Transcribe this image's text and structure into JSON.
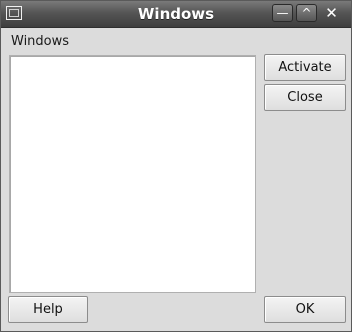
{
  "window": {
    "title": "Windows"
  },
  "titlebar": {
    "menu_icon": "window-menu-icon",
    "minimize_icon": "minimize-icon",
    "maximize_icon": "maximize-icon",
    "close_icon": "close-icon",
    "minimize_glyph": "—",
    "maximize_glyph": "^",
    "close_glyph": "✕"
  },
  "list": {
    "label": "Windows",
    "items": []
  },
  "buttons": {
    "activate": "Activate",
    "close": "Close",
    "help": "Help",
    "ok": "OK"
  }
}
